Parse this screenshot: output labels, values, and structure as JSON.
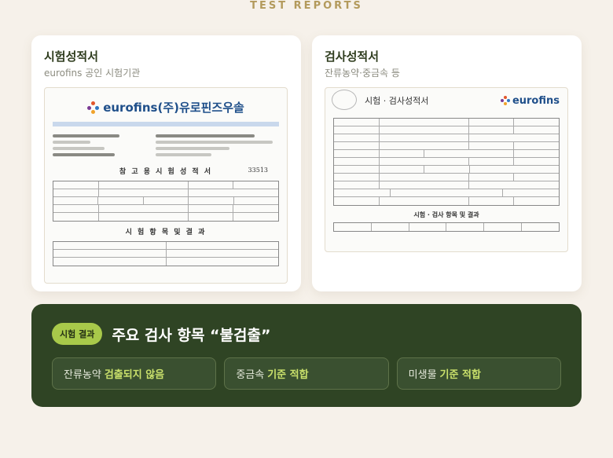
{
  "section": {
    "title": "TEST REPORTS"
  },
  "cards": [
    {
      "title": "시험성적서",
      "subtitle": "eurofins 공인 시험기관",
      "doc": {
        "logo": "eurofins(주)유로핀즈우솔",
        "heading": "참 고 용 시 험 성 적 서",
        "number": "33513",
        "section_heading": "시 험 항 목 및 결 과"
      }
    },
    {
      "title": "검사성적서",
      "subtitle": "잔류농약·중금속 등",
      "doc": {
        "logo": "eurofins",
        "heading": "시험 · 검사성적서",
        "section_heading": "시험 · 검사 항목 및 결과"
      }
    }
  ],
  "result": {
    "badge": "시험 결과",
    "title": "주요 검사 항목 “불검출”",
    "items": [
      {
        "label": "잔류농약",
        "value": "검출되지 않음"
      },
      {
        "label": "중금속",
        "value": "기준 적합"
      },
      {
        "label": "미생물",
        "value": "기준 적합"
      }
    ]
  },
  "colors": {
    "background": "#f6f1ea",
    "accent_gold": "#b39a5c",
    "panel_green": "#2f4424",
    "highlight": "#c9e06b"
  }
}
